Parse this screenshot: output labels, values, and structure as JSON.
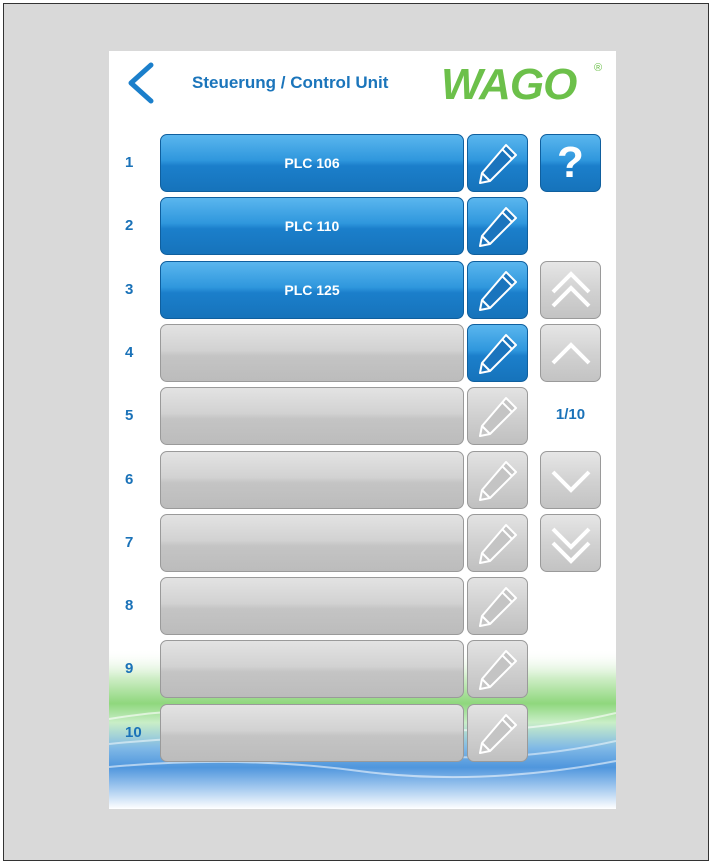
{
  "header": {
    "title": "Steuerung / Control Unit",
    "logo_text": "WAGO",
    "logo_registered": "®"
  },
  "rows": [
    {
      "number": "1",
      "label": "PLC 106",
      "active": true
    },
    {
      "number": "2",
      "label": "PLC 110",
      "active": true
    },
    {
      "number": "3",
      "label": "PLC 125",
      "active": true
    },
    {
      "number": "4",
      "label": "",
      "active": false
    },
    {
      "number": "5",
      "label": "",
      "active": false
    },
    {
      "number": "6",
      "label": "",
      "active": false
    },
    {
      "number": "7",
      "label": "",
      "active": false
    },
    {
      "number": "8",
      "label": "",
      "active": false
    },
    {
      "number": "9",
      "label": "",
      "active": false
    },
    {
      "number": "10",
      "label": "",
      "active": false
    }
  ],
  "edit_buttons_enabled": [
    true,
    true,
    true,
    true,
    false,
    false,
    false,
    false,
    false,
    false
  ],
  "side": {
    "help_label": "?",
    "page_indicator": "1/10"
  },
  "colors": {
    "accent_blue": "#1b7fcb",
    "title_blue": "#1b75bb",
    "wago_green": "#6cc04a",
    "disabled_gray": "#c8c8c8"
  },
  "icons": {
    "back": "chevron-left-icon",
    "edit": "pencil-icon",
    "help": "question-icon",
    "first_page": "double-chevron-up-icon",
    "prev_page": "chevron-up-icon",
    "next_page": "chevron-down-icon",
    "last_page": "double-chevron-down-icon"
  }
}
